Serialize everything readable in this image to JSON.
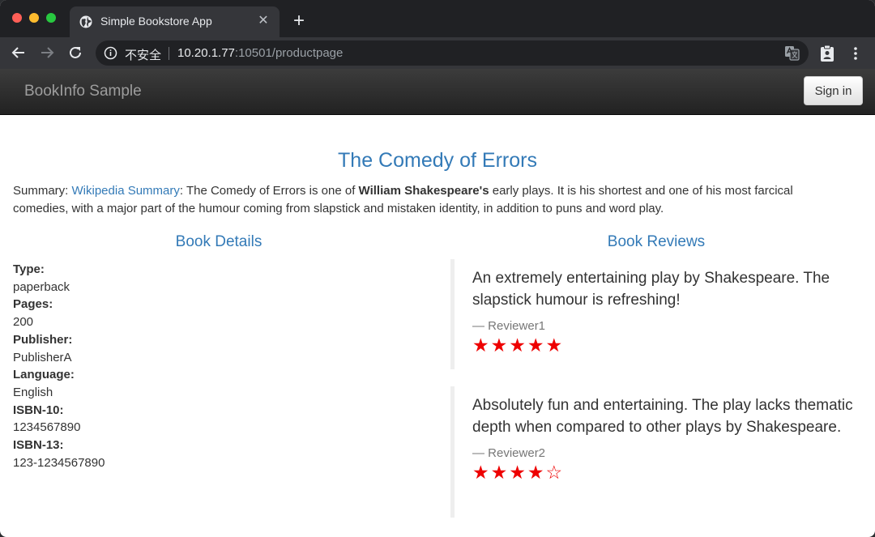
{
  "browser": {
    "tab_title": "Simple Bookstore App",
    "security_label": "不安全",
    "url_host": "10.20.1.77",
    "url_rest": ":10501/productpage"
  },
  "navbar": {
    "brand": "BookInfo Sample",
    "signin_label": "Sign in"
  },
  "book": {
    "title": "The Comedy of Errors",
    "summary_prefix": "Summary: ",
    "summary_link": "Wikipedia Summary",
    "summary_mid": ": The Comedy of Errors is one of ",
    "summary_bold": "William Shakespeare's",
    "summary_rest": " early plays. It is his shortest and one of his most farcical comedies, with a major part of the humour coming from slapstick and mistaken identity, in addition to puns and word play."
  },
  "details": {
    "heading": "Book Details",
    "fields": [
      {
        "label": "Type:",
        "value": "paperback"
      },
      {
        "label": "Pages:",
        "value": "200"
      },
      {
        "label": "Publisher:",
        "value": "PublisherA"
      },
      {
        "label": "Language:",
        "value": "English"
      },
      {
        "label": "ISBN-10:",
        "value": "1234567890"
      },
      {
        "label": "ISBN-13:",
        "value": "123-1234567890"
      }
    ]
  },
  "reviews": {
    "heading": "Book Reviews",
    "items": [
      {
        "text": "An extremely entertaining play by Shakespeare. The slapstick humour is refreshing!",
        "author": "— Reviewer1",
        "rating": 5,
        "max_rating": 5
      },
      {
        "text": "Absolutely fun and entertaining. The play lacks thematic depth when compared to other plays by Shakespeare.",
        "author": "— Reviewer2",
        "rating": 4,
        "max_rating": 5
      }
    ],
    "star_color": "#ee0000"
  }
}
